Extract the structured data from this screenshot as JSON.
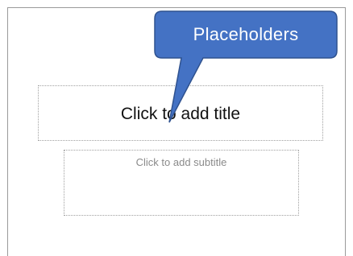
{
  "slide": {
    "title_placeholder": "Click to add title",
    "subtitle_placeholder": "Click to add subtitle"
  },
  "callout": {
    "label": "Placeholders",
    "fill_color": "#4472C4",
    "border_color": "#2F528F"
  }
}
